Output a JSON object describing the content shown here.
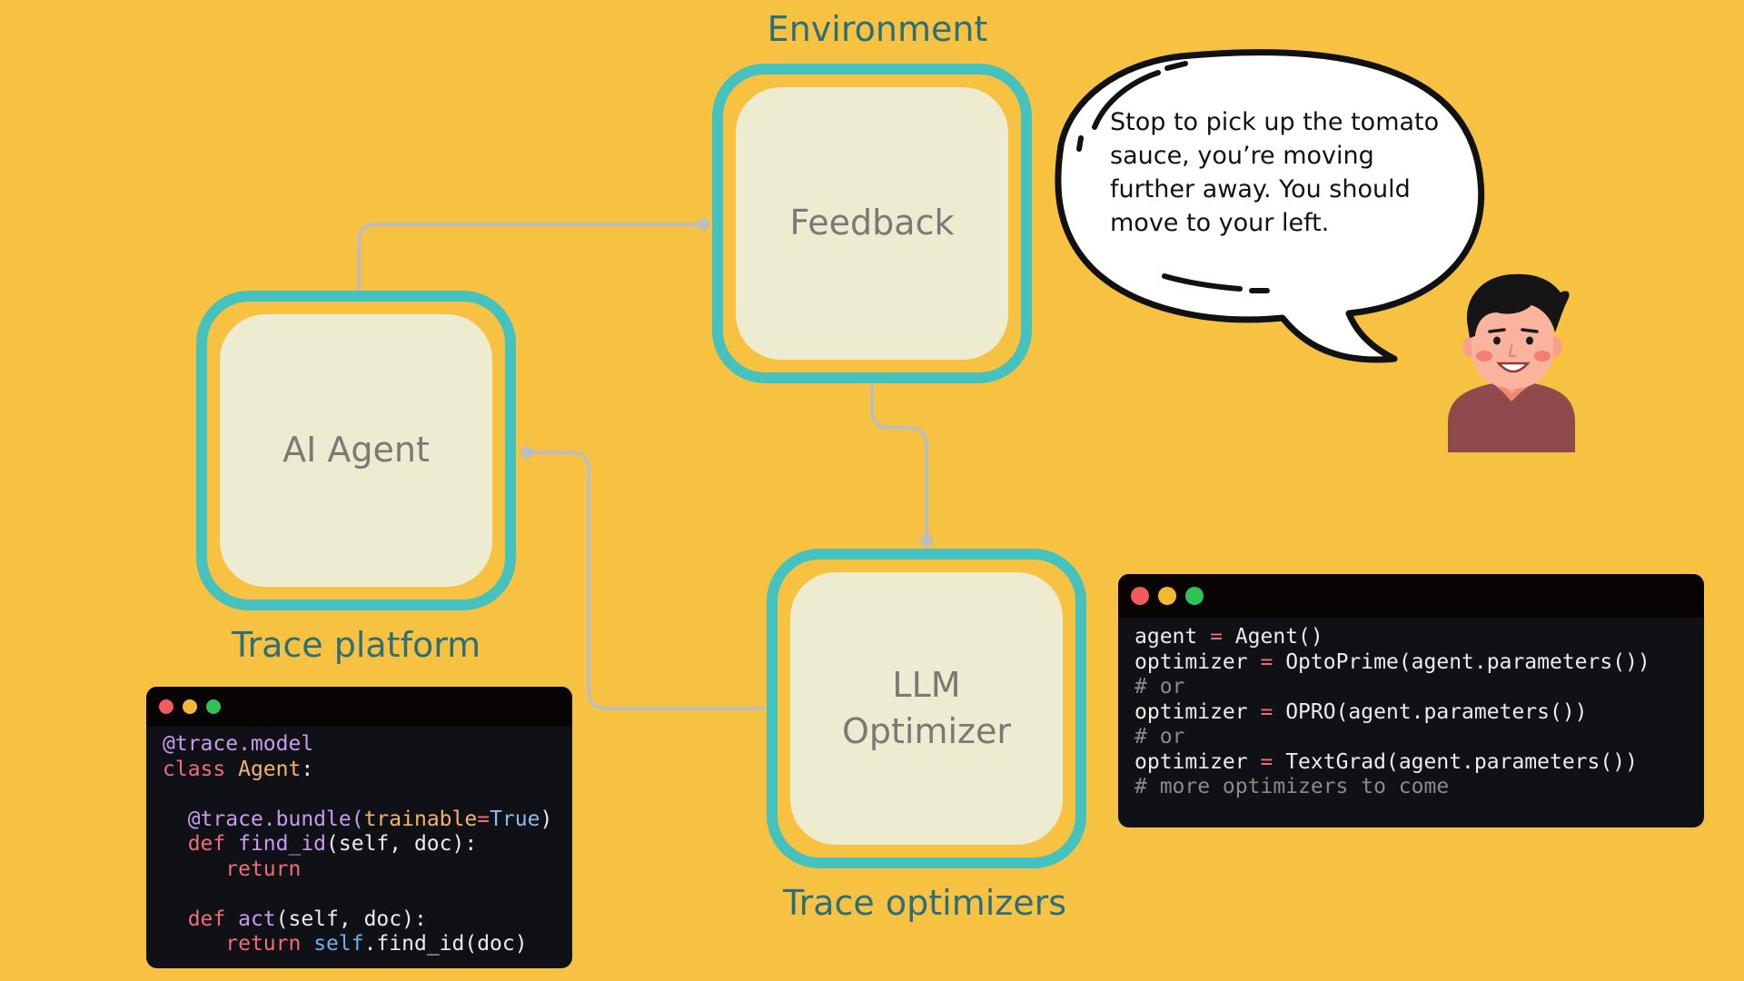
{
  "colors": {
    "background": "#F7C242",
    "node_border": "#45C1BE",
    "node_fill": "#EDEBD0",
    "label_text": "#2E6E79",
    "wire": "#BDBDBD"
  },
  "nodes": {
    "feedback": {
      "text": "Feedback",
      "label": "Environment"
    },
    "agent": {
      "text": "AI Agent",
      "label": "Trace platform"
    },
    "optimizer": {
      "text_line1": "LLM",
      "text_line2": "Optimizer",
      "label": "Trace optimizers"
    }
  },
  "speech_bubble": {
    "text": "Stop to pick up the tomato sauce, you’re moving further away. You should move to your left."
  },
  "agent_code": {
    "window_controls": [
      "close",
      "minimize",
      "maximize"
    ],
    "lines": [
      [
        {
          "t": "@trace.model",
          "c": "dec"
        }
      ],
      [
        {
          "t": "class ",
          "c": "kw"
        },
        {
          "t": "Agent",
          "c": "cls"
        },
        {
          "t": ":",
          "c": "plain"
        }
      ],
      [],
      [
        {
          "t": "  ",
          "c": "plain"
        },
        {
          "t": "@trace.bundle(",
          "c": "dec"
        },
        {
          "t": "trainable",
          "c": "arg"
        },
        {
          "t": "=",
          "c": "op"
        },
        {
          "t": "True",
          "c": "bool"
        },
        {
          "t": ")",
          "c": "plain"
        }
      ],
      [
        {
          "t": "  ",
          "c": "plain"
        },
        {
          "t": "def ",
          "c": "kw"
        },
        {
          "t": "find_id",
          "c": "fn"
        },
        {
          "t": "(self, doc):",
          "c": "plain"
        }
      ],
      [
        {
          "t": "     ",
          "c": "plain"
        },
        {
          "t": "return",
          "c": "kw"
        }
      ],
      [],
      [
        {
          "t": "  ",
          "c": "plain"
        },
        {
          "t": "def ",
          "c": "kw"
        },
        {
          "t": "act",
          "c": "fn"
        },
        {
          "t": "(self, doc):",
          "c": "plain"
        }
      ],
      [
        {
          "t": "     ",
          "c": "plain"
        },
        {
          "t": "return ",
          "c": "kw"
        },
        {
          "t": "self",
          "c": "self"
        },
        {
          "t": ".find_id(doc)",
          "c": "plain"
        }
      ]
    ]
  },
  "optimizer_code": {
    "window_controls": [
      "close",
      "minimize",
      "maximize"
    ],
    "lines": [
      [
        {
          "t": "agent ",
          "c": "plain"
        },
        {
          "t": "=",
          "c": "op"
        },
        {
          "t": " Agent()",
          "c": "plain"
        }
      ],
      [
        {
          "t": "optimizer ",
          "c": "plain"
        },
        {
          "t": "=",
          "c": "op"
        },
        {
          "t": " OptoPrime(agent.parameters())",
          "c": "plain"
        }
      ],
      [
        {
          "t": "# or",
          "c": "cm"
        }
      ],
      [
        {
          "t": "optimizer ",
          "c": "plain"
        },
        {
          "t": "=",
          "c": "op"
        },
        {
          "t": " OPRO(agent.parameters())",
          "c": "plain"
        }
      ],
      [
        {
          "t": "# or",
          "c": "cm"
        }
      ],
      [
        {
          "t": "optimizer ",
          "c": "plain"
        },
        {
          "t": "=",
          "c": "op"
        },
        {
          "t": " TextGrad(agent.parameters())",
          "c": "plain"
        }
      ],
      [
        {
          "t": "# more optimizers to come",
          "c": "cm"
        }
      ]
    ]
  }
}
